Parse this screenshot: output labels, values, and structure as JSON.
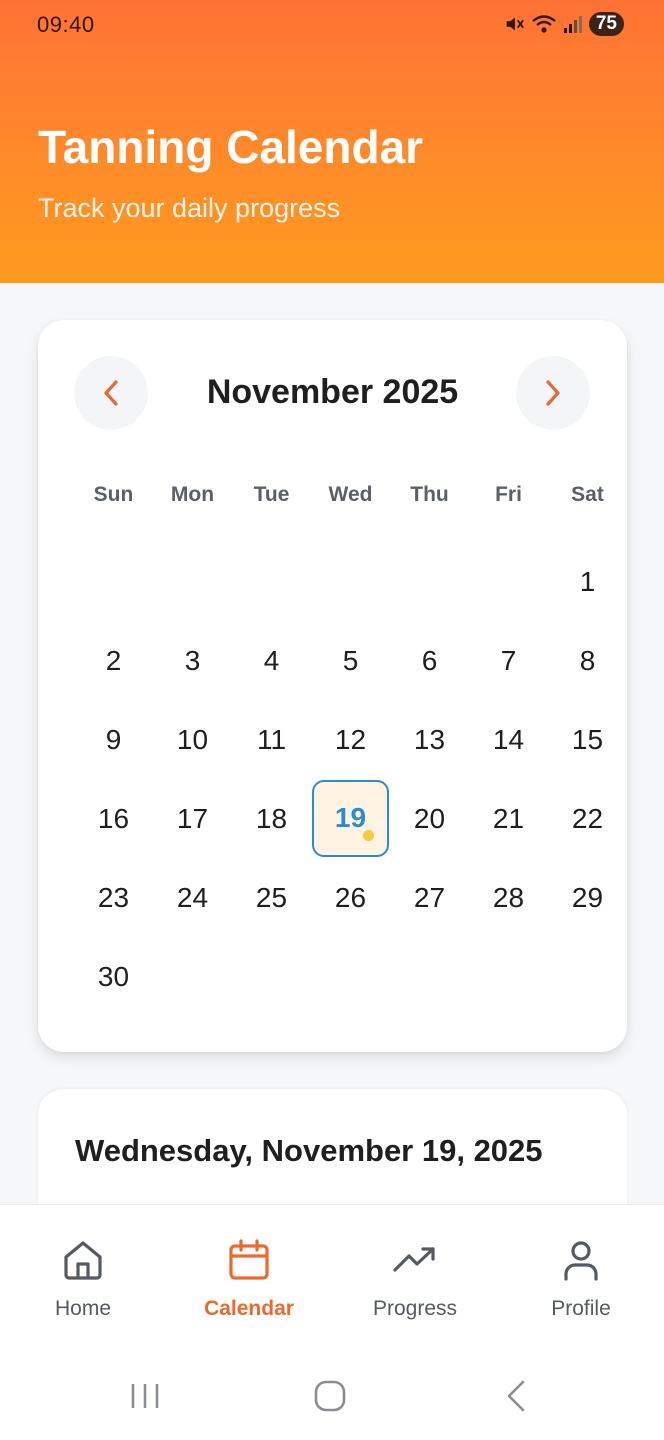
{
  "status_bar": {
    "time": "09:40",
    "battery": "75"
  },
  "header": {
    "title": "Tanning Calendar",
    "subtitle": "Track your daily progress"
  },
  "calendar": {
    "month_label": "November 2025",
    "weekdays": [
      "Sun",
      "Mon",
      "Tue",
      "Wed",
      "Thu",
      "Fri",
      "Sat"
    ],
    "first_weekday_index": 6,
    "days_in_month": 30,
    "selected_day": 19,
    "days_with_events": [
      19
    ],
    "colors": {
      "accent": "#ec6a2c",
      "selected_border": "#2b8bd6",
      "event_dot": "#f6c944"
    }
  },
  "detail": {
    "date_title": "Wednesday, November 19, 2025"
  },
  "bottom_nav": {
    "items": [
      {
        "label": "Home",
        "icon": "home-icon"
      },
      {
        "label": "Calendar",
        "icon": "calendar-icon"
      },
      {
        "label": "Progress",
        "icon": "trending-up-icon"
      },
      {
        "label": "Profile",
        "icon": "user-icon"
      }
    ],
    "active_index": 1
  },
  "system_nav": [
    "recent-apps-icon",
    "home-circle-icon",
    "back-icon"
  ]
}
